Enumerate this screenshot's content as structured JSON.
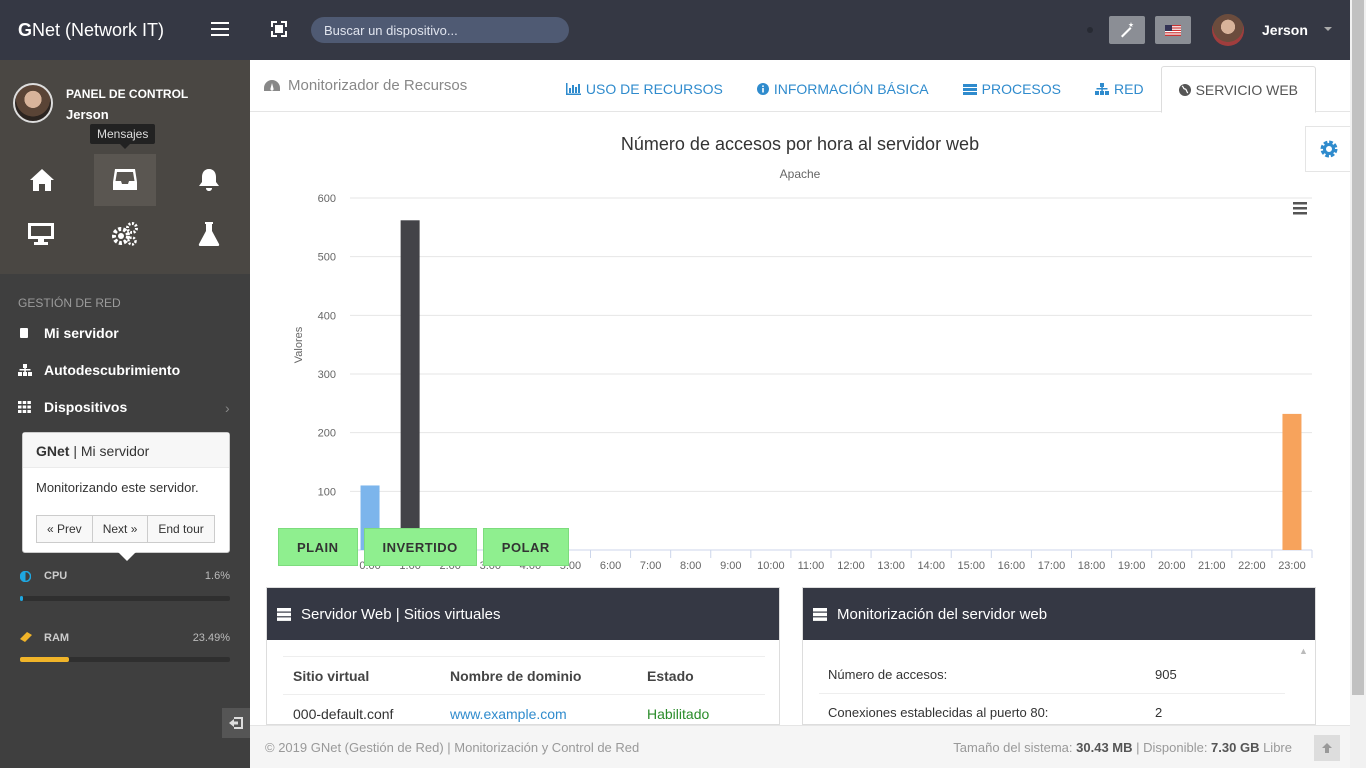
{
  "brand": {
    "bold": "G",
    "rest": "Net (Network IT)"
  },
  "user_panel": {
    "role": "PANEL DE CONTROL",
    "name": "Jerson",
    "tooltip": "Mensajes"
  },
  "nav": {
    "header": "GESTIÓN DE RED",
    "items": [
      {
        "label": "Mi servidor",
        "icon": "server-icon"
      },
      {
        "label": "Autodescubrimiento",
        "icon": "sitemap-icon"
      },
      {
        "label": "Dispositivos",
        "icon": "grid-icon"
      }
    ]
  },
  "tour": {
    "title_bold": "GNet",
    "title_rest": " | Mi servidor",
    "body": "Monitorizando este servidor.",
    "prev": "« Prev",
    "next": "Next »",
    "end": "End tour"
  },
  "resources": [
    {
      "label": "CPU",
      "value": "1.6%",
      "percent": 1.6,
      "color": "#1fa7e0"
    },
    {
      "label": "RAM",
      "value": "23.49%",
      "percent": 23.49,
      "color": "#f0b429"
    }
  ],
  "topbar": {
    "search_placeholder": "Buscar un dispositivo...",
    "user": "Jerson"
  },
  "page": {
    "title": "Monitorizador de Recursos",
    "tabs": [
      {
        "label": "USO DE RECURSOS",
        "icon": "bar-chart-icon",
        "active": false
      },
      {
        "label": "INFORMACIÓN BÁSICA",
        "icon": "info-icon",
        "active": false
      },
      {
        "label": "PROCESOS",
        "icon": "list-icon",
        "active": false
      },
      {
        "label": "RED",
        "icon": "sitemap-icon",
        "active": false
      },
      {
        "label": "SERVICIO WEB",
        "icon": "globe-icon",
        "active": true
      }
    ]
  },
  "chart_data": {
    "type": "bar",
    "title": "Número de accesos por hora al servidor web",
    "subtitle": "Apache",
    "ylabel": "Valores",
    "xlabel": "",
    "ylim": [
      0,
      600
    ],
    "yticks": [
      0,
      100,
      200,
      300,
      400,
      500,
      600
    ],
    "categories": [
      "0:00",
      "1:00",
      "2:00",
      "3:00",
      "4:00",
      "5:00",
      "6:00",
      "7:00",
      "8:00",
      "9:00",
      "10:00",
      "11:00",
      "12:00",
      "13:00",
      "14:00",
      "15:00",
      "16:00",
      "17:00",
      "18:00",
      "19:00",
      "20:00",
      "21:00",
      "22:00",
      "23:00"
    ],
    "values": [
      110,
      562,
      0,
      0,
      0,
      0,
      0,
      0,
      0,
      0,
      0,
      0,
      0,
      0,
      0,
      0,
      0,
      0,
      0,
      0,
      0,
      0,
      0,
      232
    ],
    "colors": [
      "#7cb5ec",
      "#434348",
      "#90ed7d",
      "#f7a35c",
      "#8085e9",
      "#f15c80",
      "#e4d354",
      "#2b908f",
      "#f45b5b",
      "#91e8e1",
      "#7cb5ec",
      "#434348",
      "#90ed7d",
      "#f7a35c",
      "#8085e9",
      "#f15c80",
      "#e4d354",
      "#2b908f",
      "#f45b5b",
      "#91e8e1",
      "#7cb5ec",
      "#434348",
      "#90ed7d",
      "#f7a35c"
    ],
    "grid": true,
    "legend": "none"
  },
  "chart_buttons": [
    "PLAIN",
    "INVERTIDO",
    "POLAR"
  ],
  "vhosts": {
    "title": "Servidor Web | Sitios virtuales",
    "headers": [
      "Sitio virtual",
      "Nombre de dominio",
      "Estado"
    ],
    "rows": [
      [
        "000-default.conf",
        "www.example.com",
        "Habilitado"
      ]
    ]
  },
  "monitor": {
    "title": "Monitorización del servidor web",
    "rows": [
      [
        "Número de accesos:",
        "905"
      ],
      [
        "Conexiones establecidas al puerto 80:",
        "2"
      ]
    ]
  },
  "footer": {
    "left": "© 2019 GNet (Gestión de Red) | Monitorización y Control de Red",
    "size_label": "Tamaño del sistema: ",
    "size_value": "30.43 MB",
    "avail_label": " | Disponible: ",
    "avail_value": "7.30 GB",
    "free_label": " Libre"
  }
}
